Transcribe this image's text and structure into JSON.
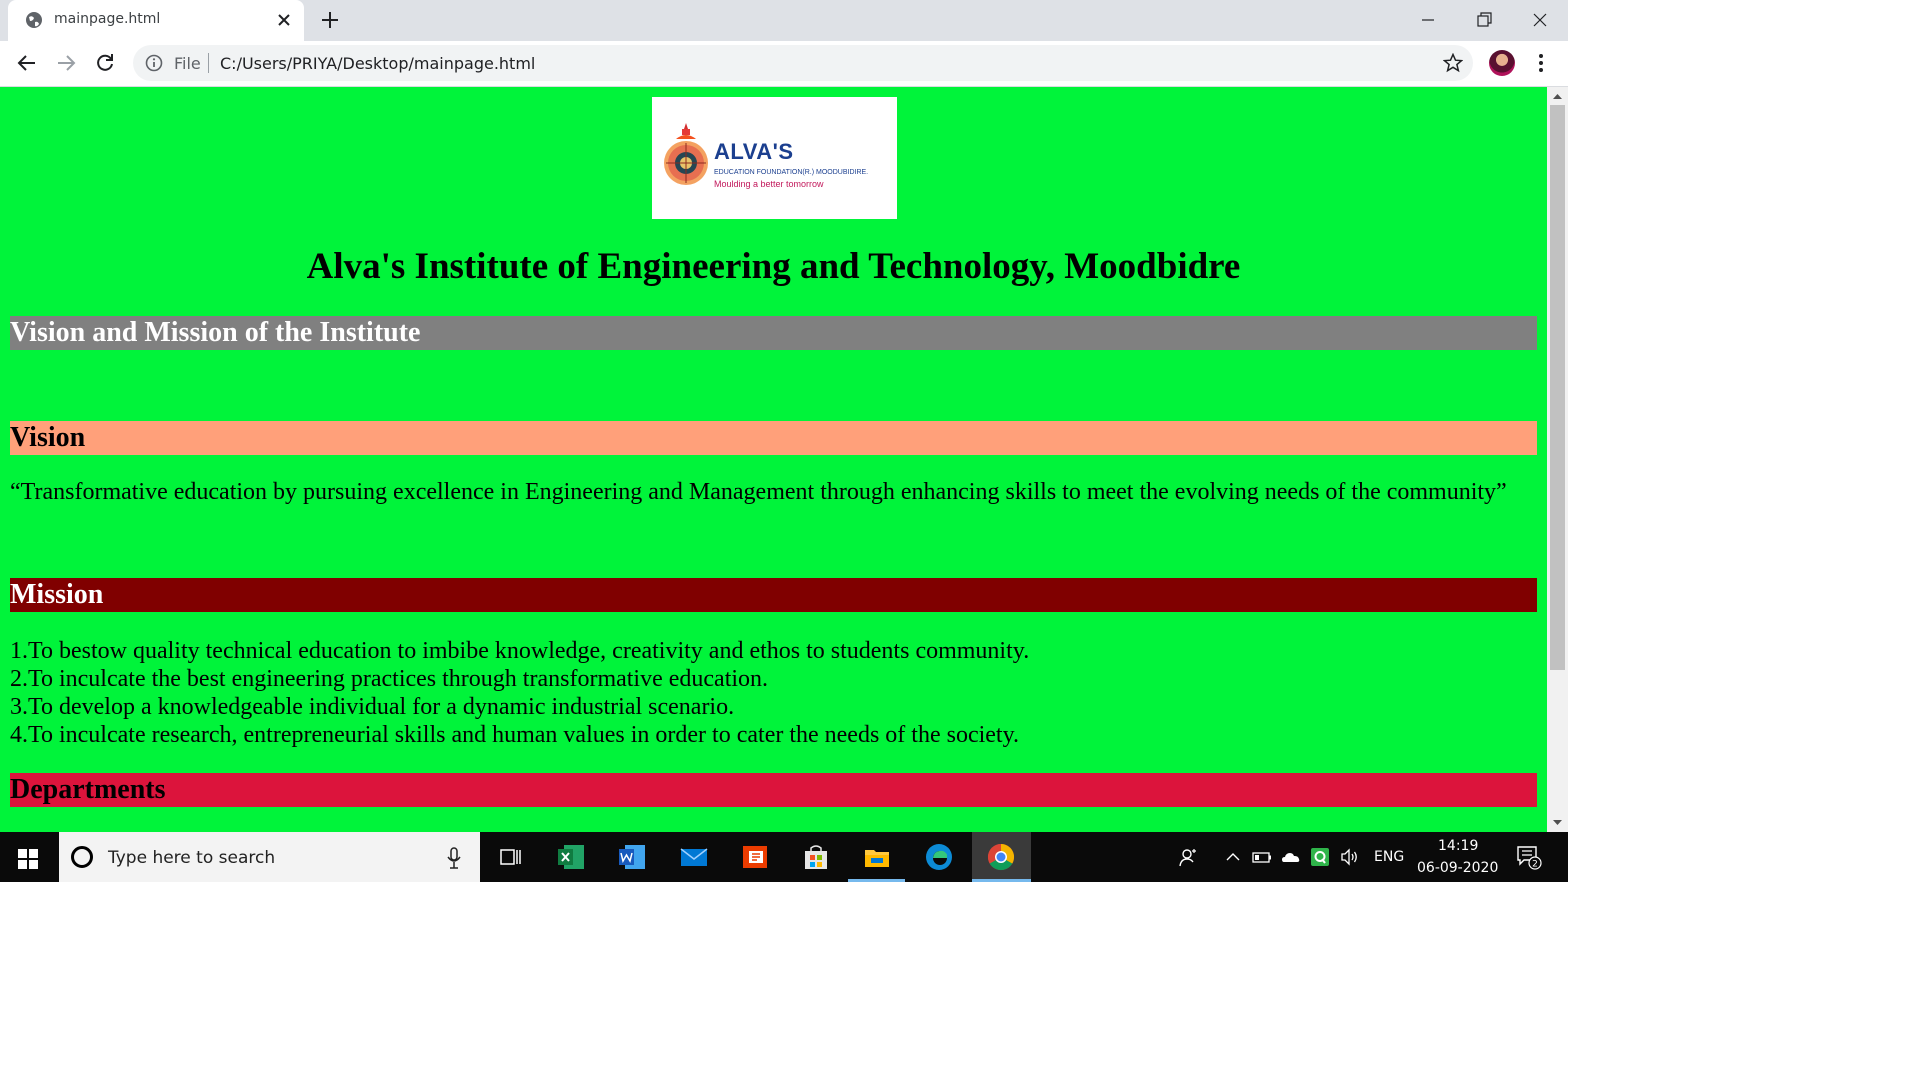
{
  "browser": {
    "tab_title": "mainpage.html",
    "file_label": "File",
    "url": "C:/Users/PRIYA/Desktop/mainpage.html"
  },
  "page": {
    "logo": {
      "name": "ALVA'S",
      "subtitle": "EDUCATION FOUNDATION(R.) MOODUBIDIRE.",
      "tagline": "Moulding a better tomorrow"
    },
    "title": "Alva's Institute of Engineering and Technology, Moodbidre",
    "sections": {
      "vision_mission_heading": "Vision and Mission of the Institute",
      "vision_heading": "Vision",
      "vision_text": "“Transformative education by pursuing excellence in Engineering and Management through enhancing skills to meet the evolving needs of the community”",
      "mission_heading": "Mission",
      "mission_items": [
        "1.To bestow quality technical education to imbibe knowledge, creativity and ethos to students community.",
        "2.To inculcate the best engineering practices through transformative education.",
        "3.To develop a knowledgeable individual for a dynamic industrial scenario.",
        "4.To inculcate research, entrepreneurial skills and human values in order to cater the needs of the society."
      ],
      "departments_heading": "Departments"
    },
    "colors": {
      "page_background": "#00f43a",
      "vision_mission_band": "#808080",
      "vision_band": "#ffa07a",
      "mission_band": "#800000",
      "departments_band": "#dc143c"
    }
  },
  "taskbar": {
    "search_placeholder": "Type here to search",
    "language": "ENG",
    "time": "14:19",
    "date": "06-09-2020",
    "notification_count": "2",
    "apps": [
      "task-view-icon",
      "excel-icon",
      "word-icon",
      "mail-icon",
      "office-icon",
      "store-icon",
      "file-explorer-icon",
      "edge-icon",
      "chrome-icon"
    ]
  }
}
